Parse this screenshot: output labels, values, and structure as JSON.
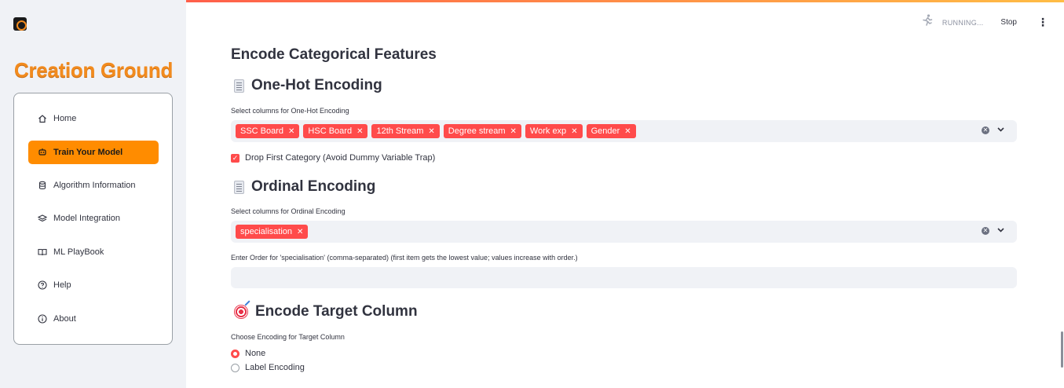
{
  "app": {
    "brand": "Creation Ground",
    "accent": "#ff4b4b",
    "brand_color": "#f28b1e",
    "active_color": "#ff8c00"
  },
  "status": {
    "running": "RUNNING...",
    "stop": "Stop"
  },
  "sidebar": {
    "items": [
      {
        "label": "Home",
        "icon": "home-icon"
      },
      {
        "label": "Train Your Model",
        "icon": "train-icon",
        "active": true
      },
      {
        "label": "Algorithm Information",
        "icon": "database-icon"
      },
      {
        "label": "Model Integration",
        "icon": "layers-icon"
      },
      {
        "label": "ML PlayBook",
        "icon": "book-icon"
      },
      {
        "label": "Help",
        "icon": "help-icon"
      },
      {
        "label": "About",
        "icon": "info-icon"
      }
    ]
  },
  "main": {
    "title": "Encode Categorical Features",
    "onehot": {
      "heading": "One-Hot Encoding",
      "select_label": "Select columns for One-Hot Encoding",
      "tags": [
        "SSC Board",
        "HSC Board",
        "12th Stream",
        "Degree stream",
        "Work exp",
        "Gender"
      ],
      "drop_first_label": "Drop First Category (Avoid Dummy Variable Trap)",
      "drop_first_checked": true
    },
    "ordinal": {
      "heading": "Ordinal Encoding",
      "select_label": "Select columns for Ordinal Encoding",
      "tags": [
        "specialisation"
      ],
      "order_label": "Enter Order for 'specialisation' (comma-separated) (first item gets the lowest value; values increase with order.)",
      "order_value": ""
    },
    "target": {
      "heading": "Encode Target Column",
      "choose_label": "Choose Encoding for Target Column",
      "options": [
        "None",
        "Label Encoding"
      ],
      "selected": "None"
    }
  }
}
